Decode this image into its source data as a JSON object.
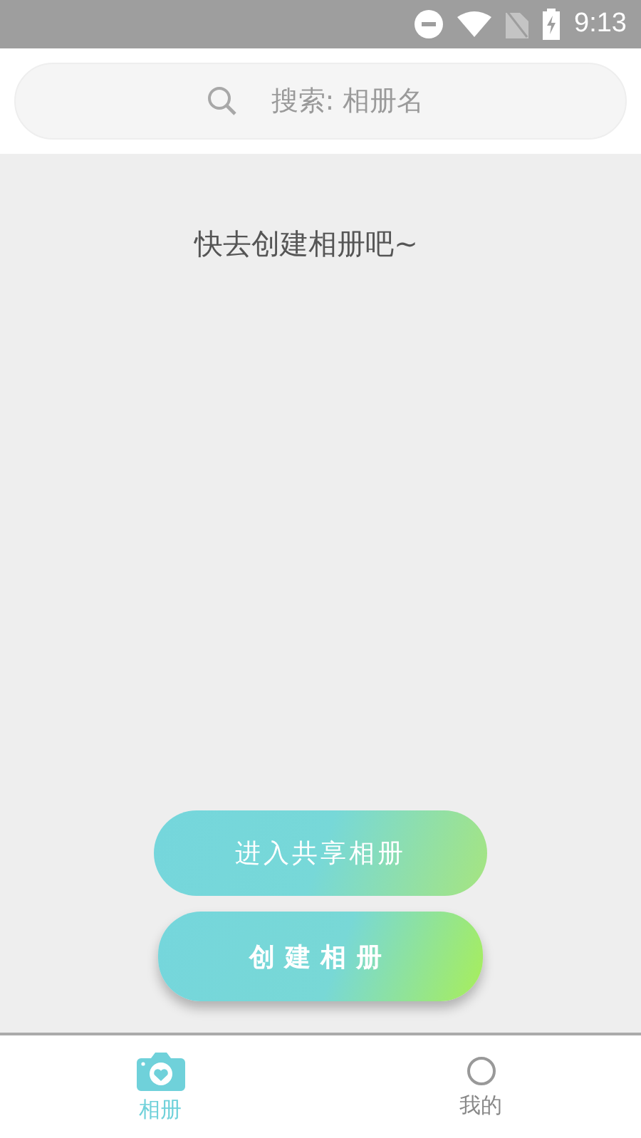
{
  "status_bar": {
    "time": "9:13"
  },
  "search": {
    "placeholder": "搜索: 相册名"
  },
  "empty_message": "快去创建相册吧~",
  "buttons": [
    {
      "label": "进入共享相册",
      "kind": "shared"
    },
    {
      "label": "创建相册",
      "kind": "create"
    }
  ],
  "bottom_nav": [
    {
      "label": "相册",
      "kind": "camera",
      "selected": true
    },
    {
      "label": "我的",
      "kind": "person",
      "selected": false
    }
  ]
}
